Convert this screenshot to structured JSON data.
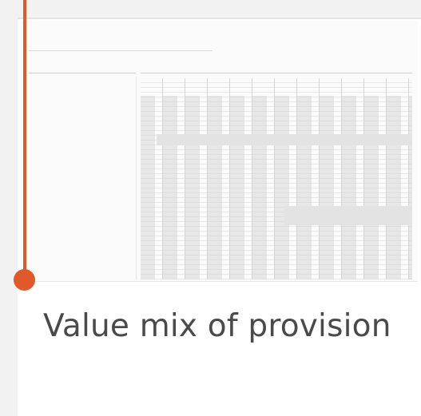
{
  "card": {
    "title": "Value mix of provision",
    "accent_color": "#e0592a"
  },
  "thumbnail": {
    "description_icon": "spreadsheet-preview"
  }
}
